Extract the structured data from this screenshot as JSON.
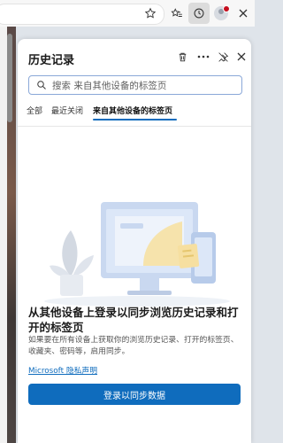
{
  "browser": {
    "toolbar_icons": [
      "star-outline-icon",
      "favorites-icon",
      "history-icon",
      "profile-avatar",
      "close-icon"
    ]
  },
  "panel": {
    "title": "历史记录",
    "header_icons": [
      "trash-icon",
      "more-icon",
      "pin-off-icon",
      "close-icon"
    ],
    "search": {
      "placeholder": "搜索 来自其他设备的标签页"
    },
    "tabs": [
      {
        "label": "全部"
      },
      {
        "label": "最近关闭"
      },
      {
        "label": "来自其他设备的标签页",
        "active": true
      }
    ],
    "empty_state": {
      "heading": "从其他设备上登录以同步浏览历史记录和打开的标签页",
      "description": "如果要在所有设备上获取你的浏览历史记录、打开的标签页、收藏夹、密码等，启用同步。",
      "privacy_link": "Microsoft 隐私声明",
      "button_label": "登录以同步数据"
    }
  },
  "colors": {
    "accent": "#0f6cbd",
    "notification_dot": "#c50f1f"
  }
}
